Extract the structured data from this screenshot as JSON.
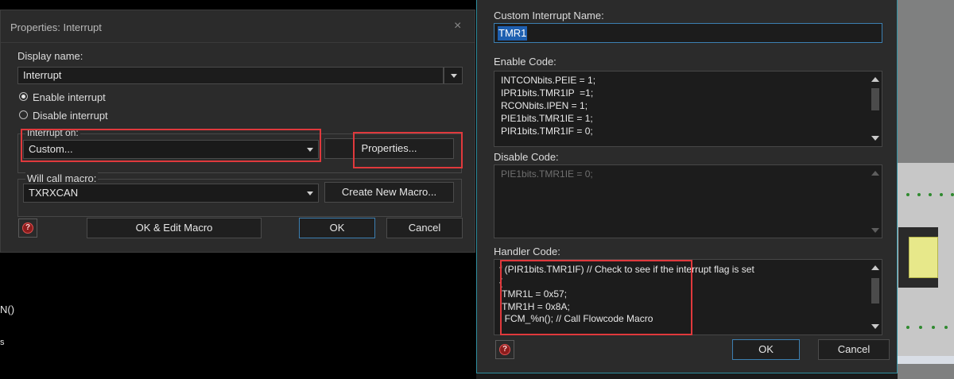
{
  "left_dialog": {
    "title": "Properties: Interrupt",
    "close_glyph": "×",
    "display_name_label": "Display name:",
    "display_name_value": "Interrupt",
    "enable_label": "Enable interrupt",
    "disable_label": "Disable interrupt",
    "enable_selected": true,
    "interrupt_on_label": "Interrupt on:",
    "interrupt_on_value": "Custom...",
    "properties_button": "Properties...",
    "will_call_label": "Will call macro:",
    "will_call_value": "TXRXCAN",
    "create_macro_button": "Create New Macro...",
    "ok_edit_button": "OK & Edit Macro",
    "ok_button": "OK",
    "cancel_button": "Cancel",
    "help_glyph": "?"
  },
  "background": {
    "fragment_1": "N()",
    "fragment_2": "s"
  },
  "right_dialog": {
    "name_label": "Custom Interrupt Name:",
    "name_value": "TMR1",
    "enable_code_label": "Enable Code:",
    "enable_code": [
      "INTCONbits.PEIE = 1;",
      "IPR1bits.TMR1IP  =1;",
      "RCONbits.IPEN = 1;",
      "PIE1bits.TMR1IE = 1;",
      "PIR1bits.TMR1IF = 0;"
    ],
    "disable_code_label": "Disable Code:",
    "disable_code": [
      "PIE1bits.TMR1IE = 0;"
    ],
    "handler_code_label": "Handler Code:",
    "handler_code": [
      "f (PIR1bits.TMR1IF) // Check to see if the interrupt flag is set",
      "{",
      " TMR1L = 0x57;",
      " TMR1H = 0x8A;",
      "  FCM_%n(); // Call Flowcode Macro"
    ],
    "ok_button": "OK",
    "cancel_button": "Cancel",
    "help_glyph": "?"
  },
  "colors": {
    "dialog_bg": "#2b2b2b",
    "field_bg": "#1c1c1c",
    "highlight_red": "#e0393c",
    "focus_blue": "#3c7fb1",
    "selection_blue": "#1e5fb0",
    "window_border_teal": "#2f8fa0"
  }
}
